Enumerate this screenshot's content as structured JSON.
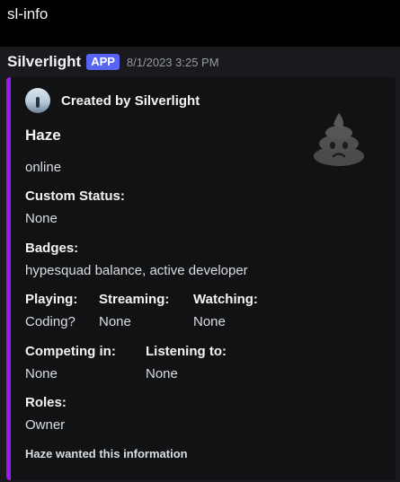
{
  "header": {
    "command": "sl-info"
  },
  "message": {
    "author": "Silverlight",
    "badge": "APP",
    "timestamp": "8/1/2023 3:25 PM"
  },
  "embed": {
    "accent_color": "#9b19f5",
    "author": "Created by Silverlight",
    "thumbnail_icon": "poop-icon",
    "title": "Haze",
    "description": "online",
    "fields": {
      "custom_status": {
        "name": "Custom Status:",
        "value": "None"
      },
      "badges": {
        "name": "Badges:",
        "value": "hypesquad balance, active developer"
      },
      "playing": {
        "name": "Playing:",
        "value": "Coding?"
      },
      "streaming": {
        "name": "Streaming:",
        "value": "None"
      },
      "watching": {
        "name": "Watching:",
        "value": "None"
      },
      "competing": {
        "name": "Competing in:",
        "value": "None"
      },
      "listening": {
        "name": "Listening to:",
        "value": "None"
      },
      "roles": {
        "name": "Roles:",
        "value": "Owner"
      }
    },
    "footer": "Haze wanted this information"
  }
}
